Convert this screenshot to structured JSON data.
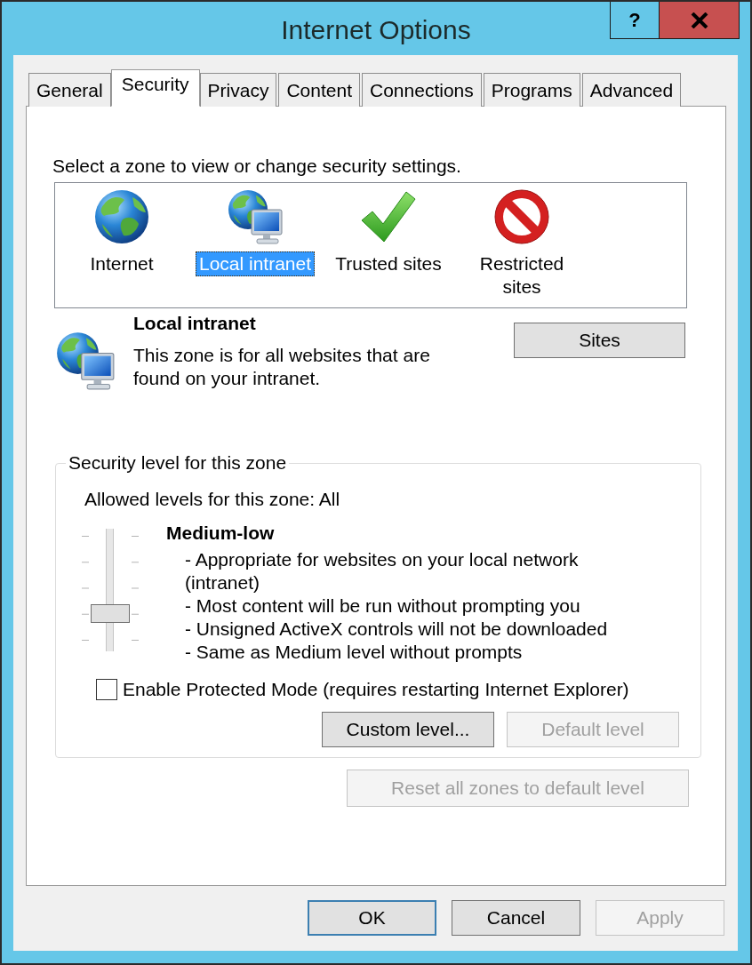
{
  "window": {
    "title": "Internet Options",
    "help_button": "?"
  },
  "tabs": [
    {
      "label": "General",
      "selected": false
    },
    {
      "label": "Security",
      "selected": true
    },
    {
      "label": "Privacy",
      "selected": false
    },
    {
      "label": "Content",
      "selected": false
    },
    {
      "label": "Connections",
      "selected": false
    },
    {
      "label": "Programs",
      "selected": false
    },
    {
      "label": "Advanced",
      "selected": false
    }
  ],
  "zones": {
    "prompt": "Select a zone to view or change security settings.",
    "items": [
      {
        "label": "Internet",
        "kind": "internet",
        "selected": false
      },
      {
        "label": "Local intranet",
        "kind": "intranet",
        "selected": true
      },
      {
        "label": "Trusted sites",
        "kind": "trusted",
        "selected": false
      },
      {
        "label": "Restricted sites",
        "kind": "restricted",
        "selected": false
      }
    ]
  },
  "zone_info": {
    "title": "Local intranet",
    "description": "This zone is for all websites that are found on your intranet.",
    "sites_button": {
      "label": "Sites",
      "disabled": false
    }
  },
  "security_level": {
    "legend": "Security level for this zone",
    "allowed": "Allowed levels for this zone: All",
    "slider": {
      "level": 0.25
    },
    "level_name": "Medium-low",
    "details": [
      "- Appropriate for websites on your local network (intranet)",
      "- Most content will be run without prompting you",
      "- Unsigned ActiveX controls will not be downloaded",
      "- Same as Medium level without prompts"
    ],
    "protected_mode": {
      "label": "Enable Protected Mode (requires restarting Internet Explorer)",
      "checked": false
    },
    "buttons": [
      {
        "label": "Custom level...",
        "disabled": false
      },
      {
        "label": "Default level",
        "disabled": true
      }
    ]
  },
  "reset_button": {
    "label": "Reset all zones to default level",
    "disabled": true
  },
  "dialog_buttons": [
    {
      "label": "OK",
      "default": true,
      "disabled": false
    },
    {
      "label": "Cancel",
      "default": false,
      "disabled": false
    },
    {
      "label": "Apply",
      "default": false,
      "disabled": true
    }
  ]
}
